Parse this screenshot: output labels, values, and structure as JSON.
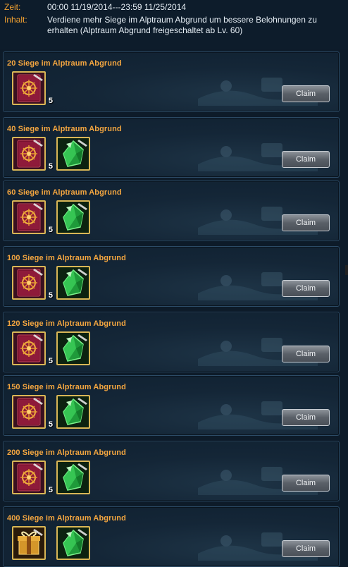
{
  "header": {
    "time_label": "Zeit:",
    "time_value": "00:00 11/19/2014---23:59 11/25/2014",
    "content_label": "Inhalt:",
    "content_value": "Verdiene mehr Siege im Alptraum Abgrund um bessere Belohnungen zu erhalten (Alptraum Abgrund freigeschaltet ab Lv. 60)"
  },
  "rewards": [
    {
      "title": "20 Siege im Alptraum Abgrund",
      "items": [
        {
          "icon": "red-rune-book-icon",
          "count": "5"
        }
      ],
      "claim": "Claim"
    },
    {
      "title": "40 Siege im Alptraum Abgrund",
      "items": [
        {
          "icon": "red-rune-book-icon",
          "count": "5"
        },
        {
          "icon": "green-crystal-icon"
        }
      ],
      "claim": "Claim"
    },
    {
      "title": "60 Siege im Alptraum Abgrund",
      "items": [
        {
          "icon": "red-rune-book-icon",
          "count": "5"
        },
        {
          "icon": "green-crystal-icon"
        }
      ],
      "claim": "Claim"
    },
    {
      "title": "100 Siege im Alptraum Abgrund",
      "items": [
        {
          "icon": "red-rune-book-icon",
          "count": "5"
        },
        {
          "icon": "green-crystal-icon"
        }
      ],
      "claim": "Claim"
    },
    {
      "title": "120 Siege im Alptraum Abgrund",
      "items": [
        {
          "icon": "red-rune-book-icon",
          "count": "5"
        },
        {
          "icon": "green-crystal-icon"
        }
      ],
      "claim": "Claim"
    },
    {
      "title": "150 Siege im Alptraum Abgrund",
      "items": [
        {
          "icon": "red-rune-book-icon",
          "count": "5"
        },
        {
          "icon": "green-crystal-icon"
        }
      ],
      "claim": "Claim"
    },
    {
      "title": "200 Siege im Alptraum Abgrund",
      "items": [
        {
          "icon": "red-rune-book-icon",
          "count": "5"
        },
        {
          "icon": "green-crystal-icon"
        }
      ],
      "claim": "Claim"
    },
    {
      "title": "400 Siege im Alptraum Abgrund",
      "items": [
        {
          "icon": "gold-gift-box-icon"
        },
        {
          "icon": "green-crystal-icon"
        }
      ],
      "claim": "Claim"
    }
  ]
}
